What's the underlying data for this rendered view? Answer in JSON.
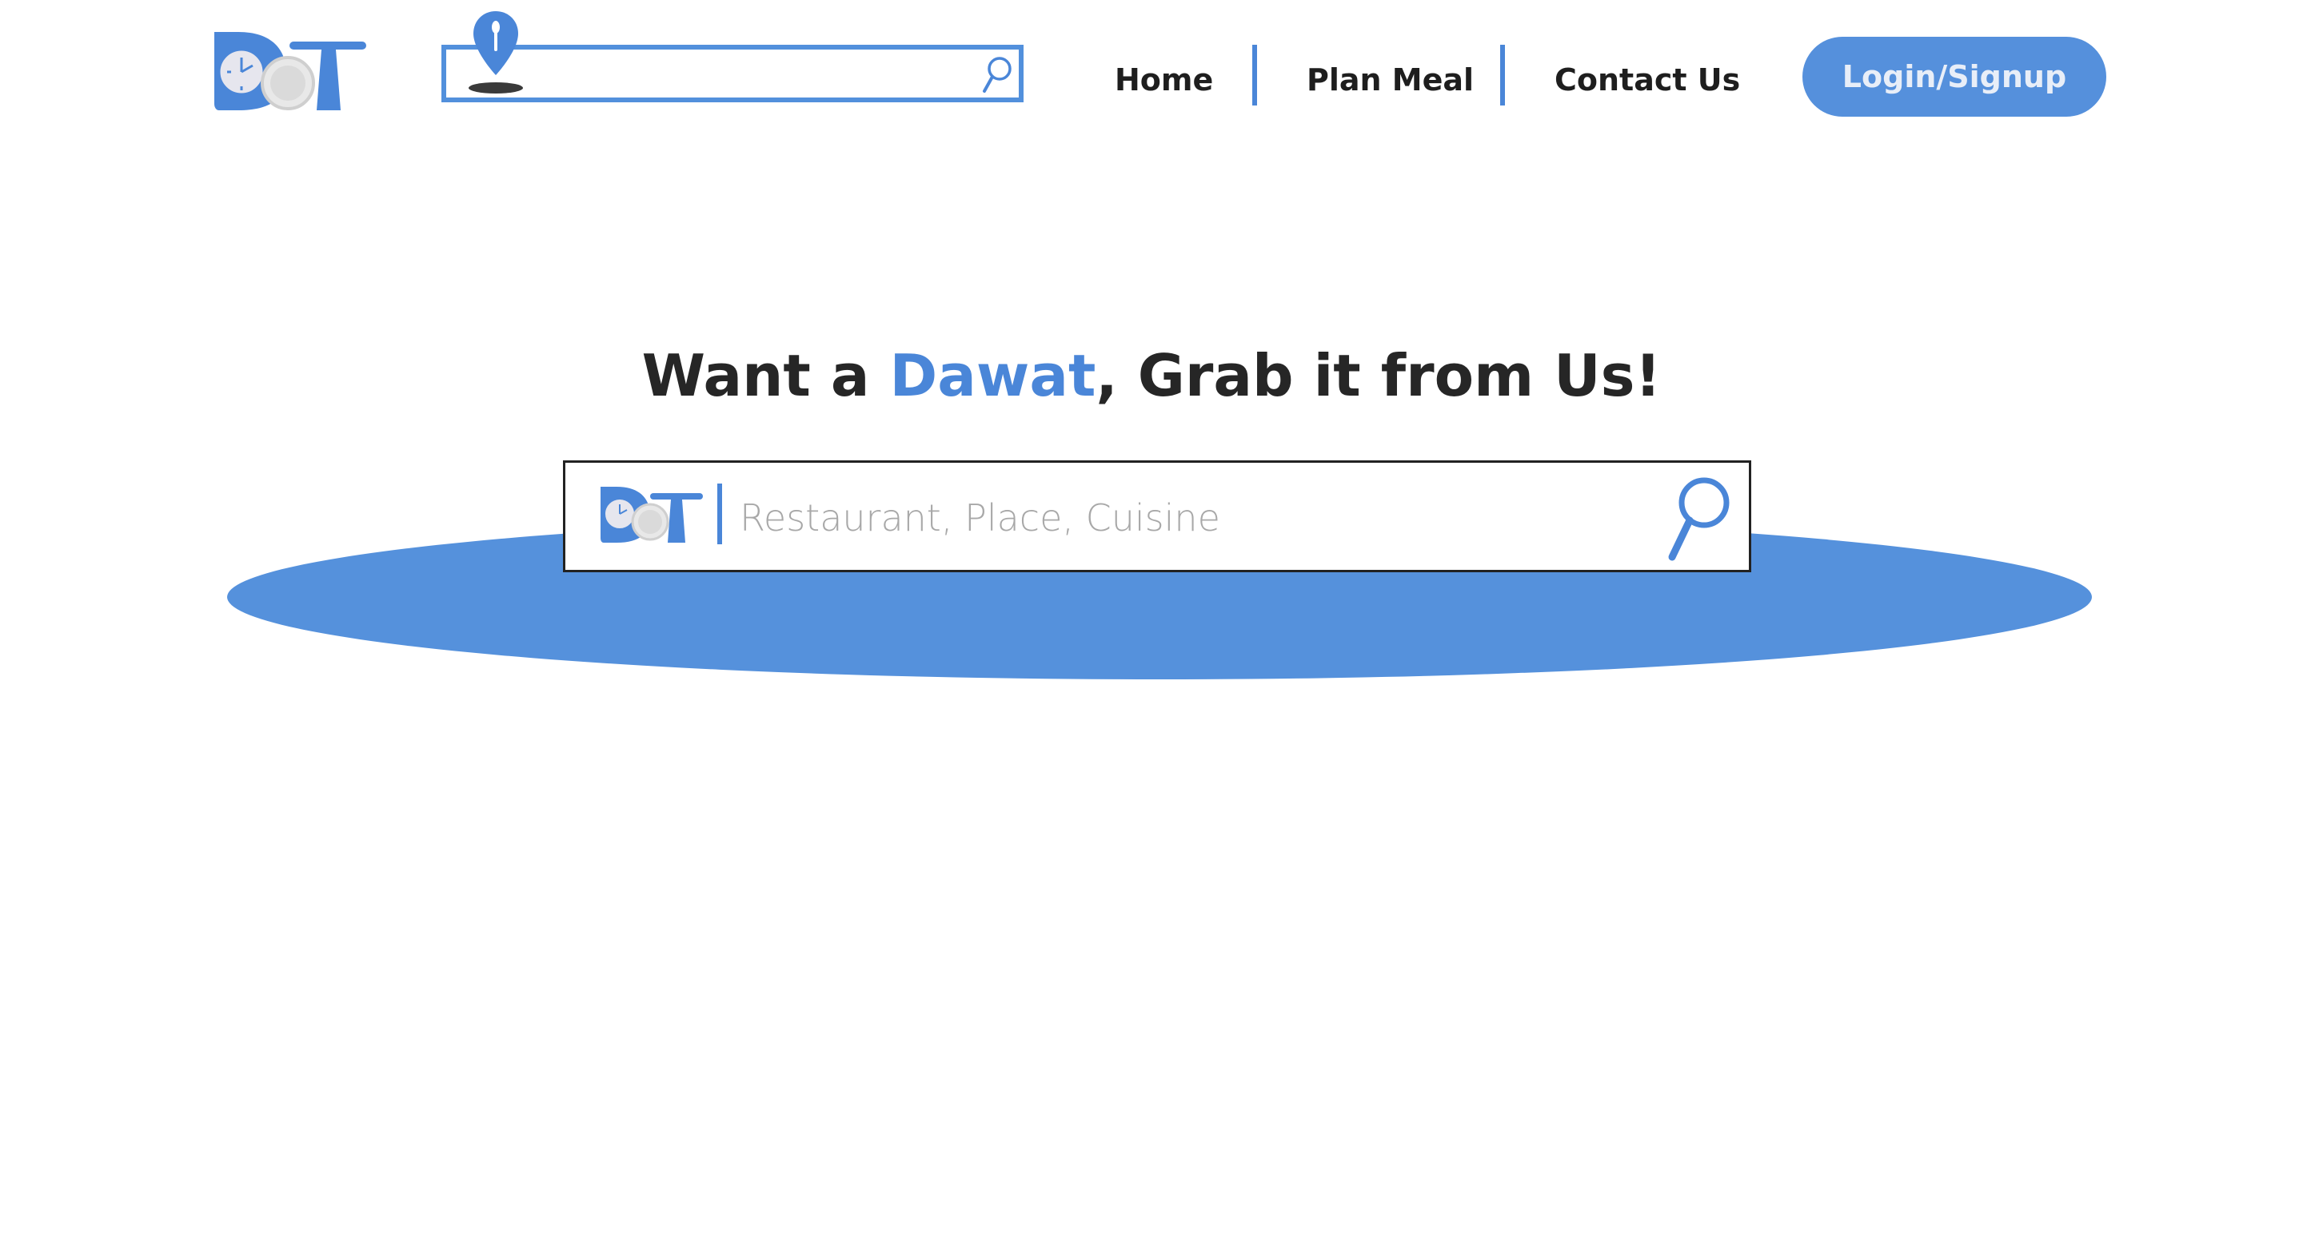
{
  "header": {
    "logo_icon": "dot-logo-icon",
    "location_icon": "location-pin-spoon-icon",
    "search_icon": "search-icon",
    "search_value": "",
    "search_placeholder": ""
  },
  "nav": {
    "items": [
      {
        "label": "Home"
      },
      {
        "label": "Plan Meal"
      },
      {
        "label": "Contact Us"
      }
    ]
  },
  "auth": {
    "login_label": "Login/Signup"
  },
  "hero": {
    "title_prefix": "Want a ",
    "title_accent": "Dawat",
    "title_suffix": ", Grab it from Us!",
    "search_placeholder": "Restaurant, Place, Cuisine",
    "search_value": "",
    "search_icon": "magnifier-icon",
    "logo_icon": "dot-logo-icon"
  },
  "colors": {
    "accent": "#4a86d8",
    "button": "#5590dc",
    "ellipse": "#5591dc",
    "text_dark": "#1e1e1e",
    "placeholder": "#a8a8a8"
  }
}
